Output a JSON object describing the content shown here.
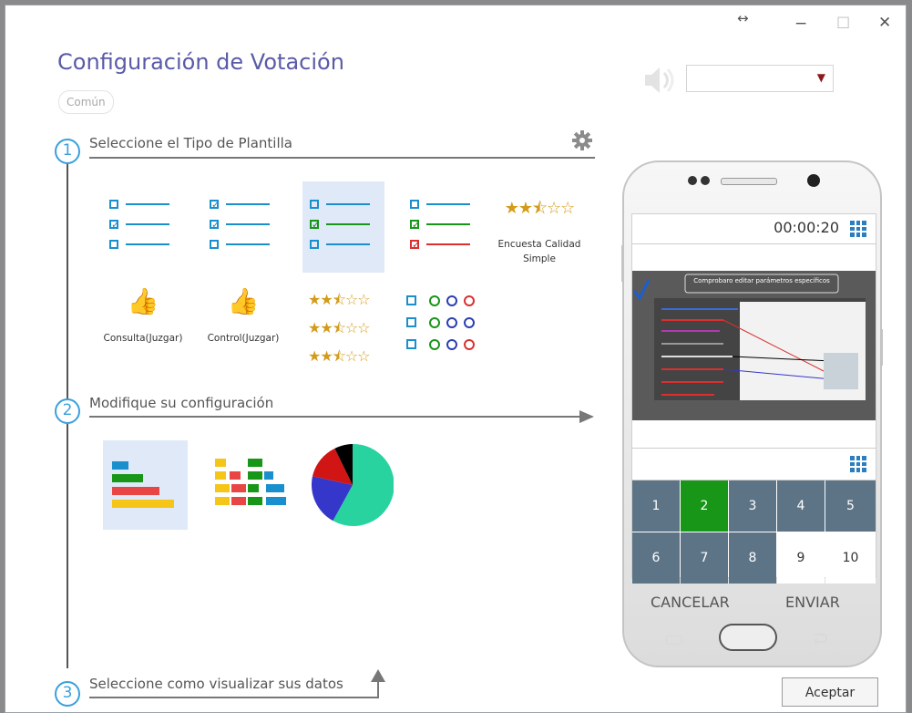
{
  "window": {
    "resize_icon": "↔",
    "minimize_icon": "−",
    "maximize_icon": "☐",
    "close_icon": "✕",
    "title": "Configuración de Votación",
    "tag": "Común",
    "speaker_icon": "speaker-icon",
    "dropdown": {
      "value": "",
      "arrow": "▼"
    },
    "accept_label": "Aceptar"
  },
  "steps": [
    {
      "num": "1",
      "label": "Seleccione el Tipo de Plantilla"
    },
    {
      "num": "2",
      "label": "Modifique su configuración"
    },
    {
      "num": "3",
      "label": "Seleccione como visualizar sus datos"
    }
  ],
  "templates": {
    "encuesta_label": "Encuesta Calidad Simple",
    "consulta_label": "Consulta(Juzgar)",
    "control_label": "Control(Juzgar)",
    "stars": "★★⯪☆☆"
  },
  "phone": {
    "timer": "00:00:20",
    "image_title": "Comprobaro editar parámetros específicos",
    "keys": [
      "1",
      "2",
      "3",
      "4",
      "5",
      "6",
      "7",
      "8",
      "9",
      "10"
    ],
    "selected_key": "2",
    "cancel_label": "CANCELAR",
    "send_label": "ENVIAR"
  },
  "colors": {
    "accent_blue": "#1a8fce",
    "title_purple": "#5a5aa8",
    "key_green": "#179617",
    "key_slate": "#5d7486"
  }
}
